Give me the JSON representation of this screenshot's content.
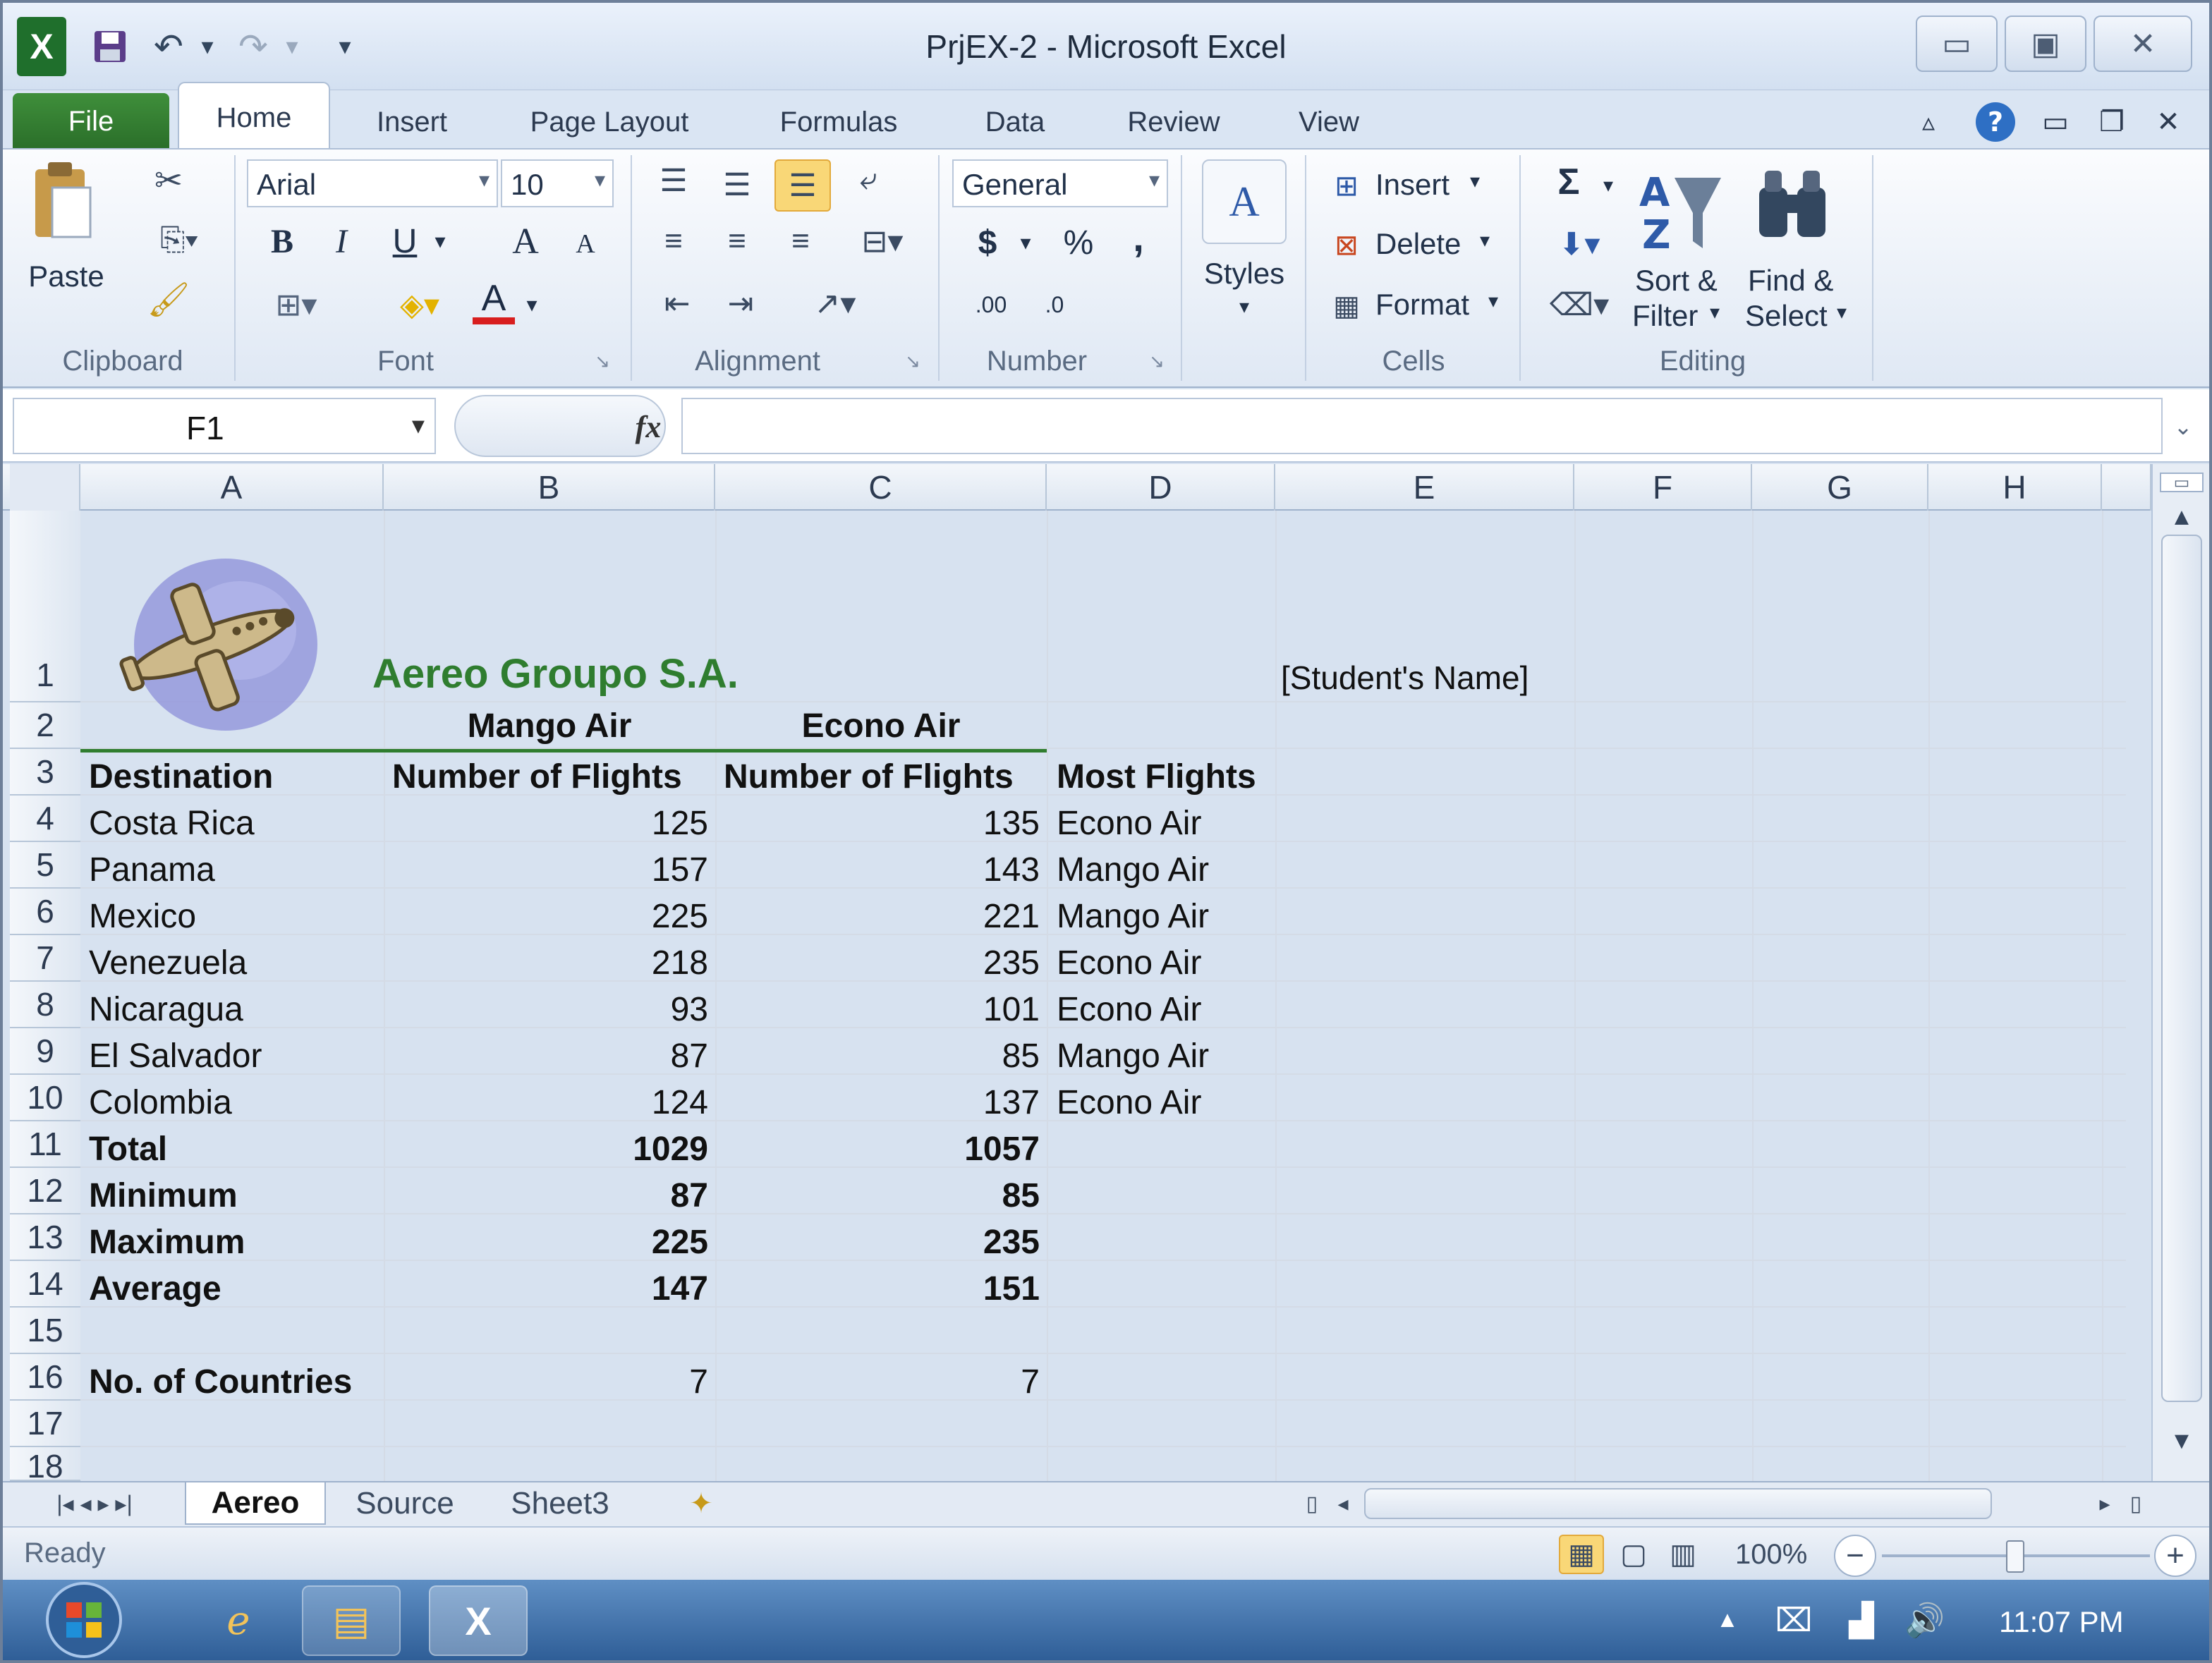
{
  "window": {
    "title": "PrjEX-2  -  Microsoft Excel"
  },
  "qat": {
    "app_icon": "X",
    "undo_icon": "↶",
    "redo_icon": "↷",
    "customize_icon": "▾"
  },
  "tabs": [
    {
      "label": "File"
    },
    {
      "label": "Home"
    },
    {
      "label": "Insert"
    },
    {
      "label": "Page Layout"
    },
    {
      "label": "Formulas"
    },
    {
      "label": "Data"
    },
    {
      "label": "Review"
    },
    {
      "label": "View"
    }
  ],
  "ribbon": {
    "clipboard": {
      "paste": "Paste",
      "label": "Clipboard"
    },
    "font": {
      "name": "Arial",
      "size": "10",
      "bold": "B",
      "italic": "I",
      "underline": "U",
      "grow": "A",
      "shrink": "A",
      "color_a": "A",
      "label": "Font"
    },
    "alignment": {
      "label": "Alignment"
    },
    "number": {
      "format": "General",
      "currency": "$",
      "percent": "%",
      "comma": ",",
      "inc_dec": ".00",
      "dec_dec": ".0",
      "label": "Number"
    },
    "styles": {
      "label": "Styles"
    },
    "cells": {
      "insert": "Insert",
      "delete": "Delete",
      "format": "Format",
      "label": "Cells"
    },
    "editing": {
      "sigma": "Σ",
      "sort": "Sort &",
      "sort2": "Filter",
      "find": "Find &",
      "find2": "Select",
      "label": "Editing"
    }
  },
  "formula_bar": {
    "name_box": "F1",
    "fx": "fx",
    "formula": ""
  },
  "columns": [
    "A",
    "B",
    "C",
    "D",
    "E",
    "F",
    "G",
    "H"
  ],
  "rows": [
    "1",
    "2",
    "3",
    "4",
    "5",
    "6",
    "7",
    "8",
    "9",
    "10",
    "11",
    "12",
    "13",
    "14",
    "15",
    "16",
    "17",
    "18"
  ],
  "sheet": {
    "company": "Aereo Groupo S.A.",
    "student": "[Student's Name]",
    "airline1": "Mango Air",
    "airline2": "Econo Air",
    "headers": [
      "Destination",
      "Number of Flights",
      "Number of Flights",
      "Most Flights"
    ],
    "data": [
      {
        "dest": "Costa Rica",
        "mango": "125",
        "econo": "135",
        "most": "Econo Air"
      },
      {
        "dest": "Panama",
        "mango": "157",
        "econo": "143",
        "most": "Mango Air"
      },
      {
        "dest": "Mexico",
        "mango": "225",
        "econo": "221",
        "most": "Mango Air"
      },
      {
        "dest": "Venezuela",
        "mango": "218",
        "econo": "235",
        "most": "Econo Air"
      },
      {
        "dest": "Nicaragua",
        "mango": "93",
        "econo": "101",
        "most": "Econo Air"
      },
      {
        "dest": "El Salvador",
        "mango": "87",
        "econo": "85",
        "most": "Mango Air"
      },
      {
        "dest": "Colombia",
        "mango": "124",
        "econo": "137",
        "most": "Econo Air"
      }
    ],
    "summary": [
      {
        "label": "Total",
        "mango": "1029",
        "econo": "1057"
      },
      {
        "label": "Minimum",
        "mango": "87",
        "econo": "85"
      },
      {
        "label": "Maximum",
        "mango": "225",
        "econo": "235"
      },
      {
        "label": "Average",
        "mango": "147",
        "econo": "151"
      }
    ],
    "countries": {
      "label": "No. of Countries",
      "mango": "7",
      "econo": "7"
    }
  },
  "sheet_tabs": [
    "Aereo",
    "Source",
    "Sheet3"
  ],
  "status": {
    "ready": "Ready",
    "zoom": "100%",
    "minus": "−",
    "plus": "+"
  },
  "taskbar": {
    "clock": "11:07 PM",
    "excel": "X"
  },
  "colors": {
    "accent_green": "#2f7d2f",
    "header_blue": "#dde6f1"
  }
}
